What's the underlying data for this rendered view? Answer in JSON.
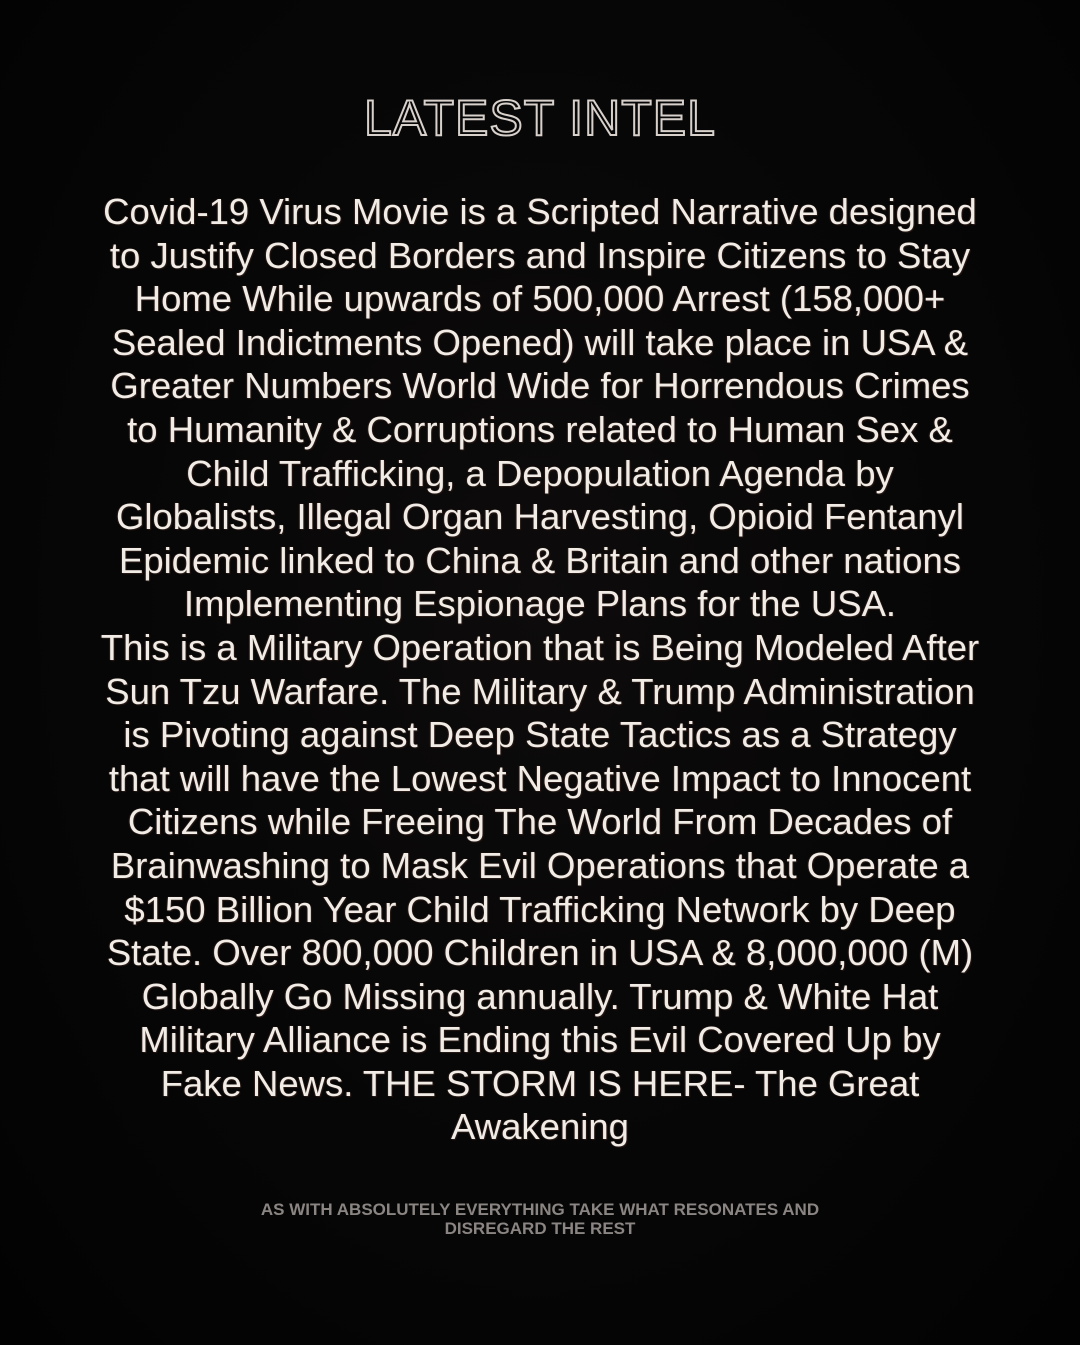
{
  "title": "LATEST INTEL",
  "body_lines": [
    "Covid-19 Virus Movie is a Scripted Narrative designed",
    "to Justify Closed Borders and Inspire Citizens to Stay",
    "Home While upwards of 500,000 Arrest (158,000+",
    "Sealed Indictments Opened) will take place in USA &",
    "Greater Numbers World Wide for Horrendous Crimes",
    "to Humanity & Corruptions related to Human Sex &",
    "Child Trafficking, a Depopulation Agenda by",
    "Globalists, Illegal Organ Harvesting, Opioid Fentanyl",
    "Epidemic linked to China & Britain and other nations",
    "Implementing Espionage Plans for the USA.",
    "This is a Military Operation that is Being Modeled After",
    "Sun Tzu Warfare. The Military & Trump Administration",
    "is Pivoting against Deep State Tactics as a Strategy",
    "that will have the Lowest Negative Impact to Innocent",
    "Citizens while Freeing The World From Decades of",
    "Brainwashing to Mask Evil Operations that Operate a",
    "$150 Billion Year Child Trafficking Network by Deep",
    "State. Over 800,000 Children in USA & 8,000,000 (M)",
    "Globally Go Missing annually. Trump & White Hat",
    "Military Alliance is Ending this Evil Covered Up by",
    "Fake News. THE STORM IS HERE- The Great",
    "Awakening"
  ],
  "footer_lines": [
    "AS WITH ABSOLUTELY EVERYTHING TAKE WHAT RESONATES AND",
    "DISREGARD THE REST"
  ],
  "colors": {
    "background": "#050505",
    "text": "#f1ece6",
    "title_outline": "#d7d0cb",
    "footer": "#8a8582"
  }
}
